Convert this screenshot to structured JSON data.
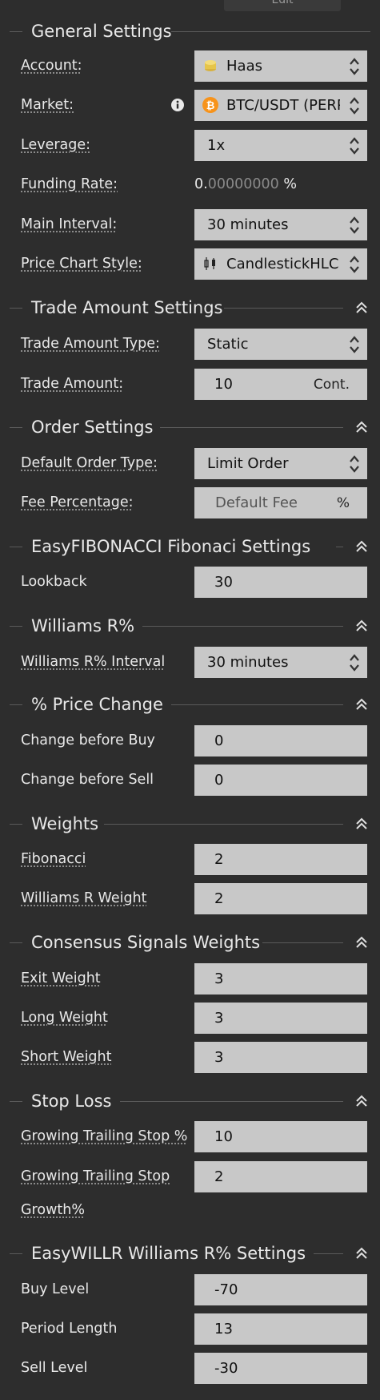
{
  "top_stub": {
    "label": "Edit"
  },
  "colors": {
    "background": "#2d2d2d",
    "field": "#c8c8c8",
    "text": "#e9e9e9",
    "bitcoin": "#f7931a",
    "haas_coin": "#e6c54a"
  },
  "sections": {
    "general": {
      "title": "General Settings",
      "account": {
        "label": "Account:",
        "value": "Haas",
        "icon": "coin-icon"
      },
      "market": {
        "label": "Market:",
        "value": "BTC/USDT (PERP)",
        "icon": "bitcoin-icon",
        "info_icon": "info-icon"
      },
      "leverage": {
        "label": "Leverage:",
        "value": "1x"
      },
      "funding_rate": {
        "label": "Funding Rate:",
        "value_int": "0.",
        "value_dec": "00000000",
        "unit": "%"
      },
      "main_interval": {
        "label": "Main Interval:",
        "value": "30 minutes"
      },
      "price_chart_style": {
        "label": "Price Chart Style:",
        "value": "CandlestickHLC",
        "icon": "candlestick-icon"
      }
    },
    "trade_amount": {
      "title": "Trade Amount Settings",
      "type": {
        "label": "Trade Amount Type:",
        "value": "Static"
      },
      "amount": {
        "label": "Trade Amount:",
        "value": "10",
        "unit": "Cont."
      }
    },
    "order": {
      "title": "Order Settings",
      "default_type": {
        "label": "Default Order Type:",
        "value": "Limit Order"
      },
      "fee": {
        "label": "Fee Percentage:",
        "placeholder": "Default Fee",
        "unit": "%"
      }
    },
    "fibonacci": {
      "title": "EasyFIBONACCI Fibonaci Settings",
      "lookback": {
        "label": "Lookback",
        "value": "30"
      }
    },
    "williams": {
      "title": "Williams R%",
      "interval": {
        "label": "Williams R% Interval",
        "value": "30 minutes"
      }
    },
    "price_change": {
      "title": "% Price Change",
      "before_buy": {
        "label": "Change before Buy",
        "value": "0"
      },
      "before_sell": {
        "label": "Change before Sell",
        "value": "0"
      }
    },
    "weights": {
      "title": "Weights",
      "fibonacci": {
        "label": "Fibonacci",
        "value": "2"
      },
      "williams": {
        "label": "Williams R Weight",
        "value": "2"
      }
    },
    "consensus": {
      "title": "Consensus Signals Weights",
      "exit": {
        "label": "Exit Weight",
        "value": "3"
      },
      "long": {
        "label": "Long Weight",
        "value": "3"
      },
      "short": {
        "label": "Short Weight",
        "value": "3"
      }
    },
    "stop_loss": {
      "title": "Stop Loss",
      "growing_trailing": {
        "label": "Growing Trailing Stop %",
        "value": "10"
      },
      "growth": {
        "label_line1": "Growing Trailing Stop",
        "label_line2": "Growth%",
        "value": "2"
      }
    },
    "willr": {
      "title": "EasyWILLR Williams R% Settings",
      "buy_level": {
        "label": "Buy Level",
        "value": "-70"
      },
      "period_length": {
        "label": "Period Length",
        "value": "13"
      },
      "sell_level": {
        "label": "Sell Level",
        "value": "-30"
      }
    }
  }
}
